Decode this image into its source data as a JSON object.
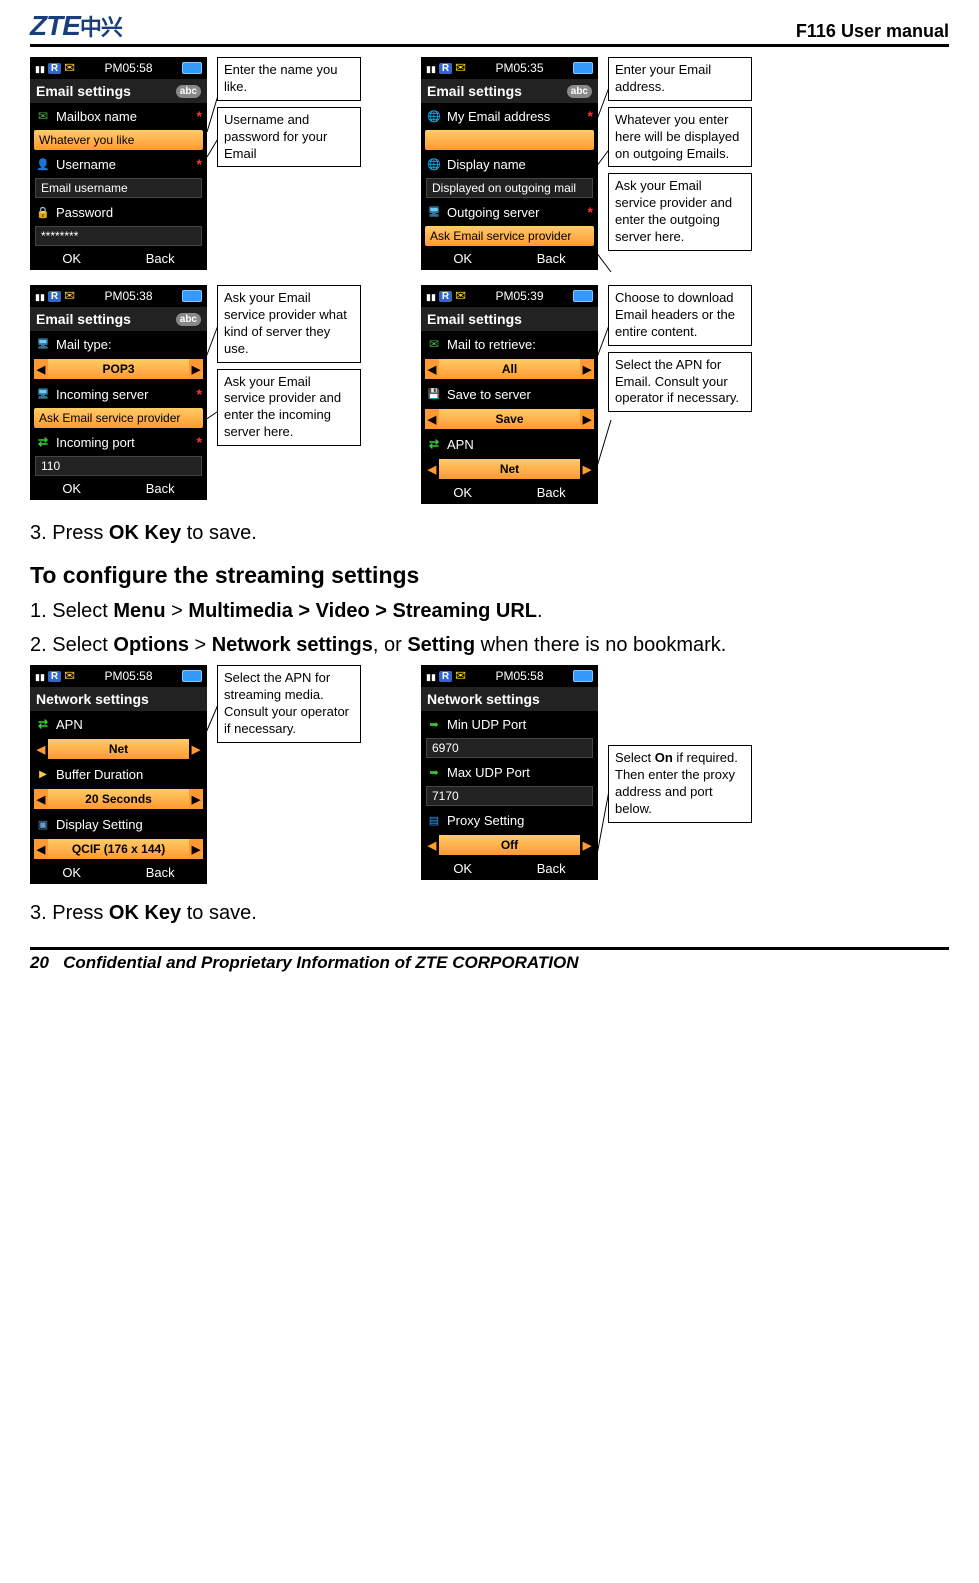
{
  "header": {
    "brand": "ZTE",
    "brand_cn": "中兴",
    "doc_title": "F116 User manual"
  },
  "footer": {
    "page_num": "20",
    "text": "Confidential and Proprietary Information of ZTE CORPORATION"
  },
  "screens": {
    "email1": {
      "time": "PM05:58",
      "title": "Email settings",
      "abc": "abc",
      "rows": [
        {
          "icon": "mail",
          "label": "Mailbox name",
          "req": true
        },
        {
          "hl": true,
          "text": "Whatever you like"
        },
        {
          "icon": "user",
          "label": "Username",
          "req": true
        },
        {
          "input": true,
          "text": "Email username"
        },
        {
          "icon": "lock",
          "label": "Password"
        },
        {
          "input": true,
          "text": "********"
        }
      ],
      "sk_left": "OK",
      "sk_right": "Back",
      "callouts": [
        "Enter the name you like.",
        "Username and password for your Email"
      ]
    },
    "email2": {
      "time": "PM05:35",
      "title": "Email settings",
      "abc": "abc",
      "rows": [
        {
          "icon": "globe",
          "label": "My Email address",
          "req": true
        },
        {
          "hl": true,
          "text": ""
        },
        {
          "icon": "globe",
          "label": "Display name"
        },
        {
          "input": true,
          "text": "Displayed on outgoing mail"
        },
        {
          "icon": "server",
          "label": "Outgoing server",
          "req": true
        },
        {
          "hl": true,
          "text": "Ask Email service provider"
        }
      ],
      "sk_left": "OK",
      "sk_right": "Back",
      "callouts": [
        "Enter your Email address.",
        "Whatever you enter here will be displayed on outgoing Emails.",
        "Ask your Email service provider and enter the outgoing server here."
      ]
    },
    "email3": {
      "time": "PM05:38",
      "title": "Email settings",
      "abc": "abc",
      "rows": [
        {
          "icon": "server",
          "label": "Mail type:"
        },
        {
          "selector": true,
          "text": "POP3"
        },
        {
          "icon": "server",
          "label": "Incoming server",
          "req": true
        },
        {
          "hl": true,
          "text": "Ask Email service provider"
        },
        {
          "icon": "apn",
          "label": "Incoming port",
          "req": true
        },
        {
          "input": true,
          "text": "110"
        }
      ],
      "sk_left": "OK",
      "sk_right": "Back",
      "callouts": [
        "Ask your Email service provider what kind of server they use.",
        "Ask your Email service provider and enter the incoming server here."
      ]
    },
    "email4": {
      "time": "PM05:39",
      "title": "Email settings",
      "rows": [
        {
          "icon": "mail",
          "label": "Mail to retrieve:"
        },
        {
          "selector": true,
          "text": "All"
        },
        {
          "icon": "save",
          "label": "Save to server"
        },
        {
          "selector": true,
          "text": "Save"
        },
        {
          "icon": "apn",
          "label": "APN"
        },
        {
          "selector": true,
          "text": "Net",
          "highlighted": true
        }
      ],
      "sk_left": "OK",
      "sk_right": "Back",
      "callouts": [
        "Choose to download Email headers or the entire content.",
        "Select the APN for Email. Consult your operator if necessary."
      ]
    },
    "net1": {
      "time": "PM05:58",
      "title": "Network settings",
      "rows": [
        {
          "icon": "apn",
          "label": "APN"
        },
        {
          "selector": true,
          "text": "Net",
          "highlighted": true
        },
        {
          "icon": "buffer",
          "label": "Buffer Duration"
        },
        {
          "selector": true,
          "text": "20 Seconds"
        },
        {
          "icon": "disp",
          "label": "Display Setting"
        },
        {
          "selector": true,
          "text": "QCIF (176 x 144)"
        }
      ],
      "sk_left": "OK",
      "sk_right": "Back",
      "callouts": [
        "Select the APN for streaming media. Consult your operator if necessary."
      ]
    },
    "net2": {
      "time": "PM05:58",
      "title": "Network settings",
      "rows": [
        {
          "icon": "port",
          "label": "Min UDP Port"
        },
        {
          "input": true,
          "text": "6970"
        },
        {
          "icon": "port",
          "label": "Max UDP Port"
        },
        {
          "input": true,
          "text": "7170"
        },
        {
          "icon": "proxy",
          "label": "Proxy Setting"
        },
        {
          "selector": true,
          "text": "Off",
          "highlighted": true
        }
      ],
      "sk_left": "OK",
      "sk_right": "Back",
      "callouts": [
        "Select On if required. Then enter the proxy address and port below."
      ]
    }
  },
  "body": {
    "step3_top": "3.   Press ",
    "ok_key": "OK Key",
    "to_save": " to save.",
    "section_title": "To configure the streaming settings",
    "step1_a": "1. Select ",
    "menu": "Menu",
    "gt": " > ",
    "path1": "Multimedia > Video > Streaming URL",
    "period": ".",
    "step2_a": "2. Select ",
    "options": "Options",
    "net_settings": "Network settings",
    "step2_b": ", or ",
    "setting": "Setting",
    "step2_c": " when there is no bookmark.",
    "step3_bottom": "3. Press ",
    "on_word": "On"
  }
}
